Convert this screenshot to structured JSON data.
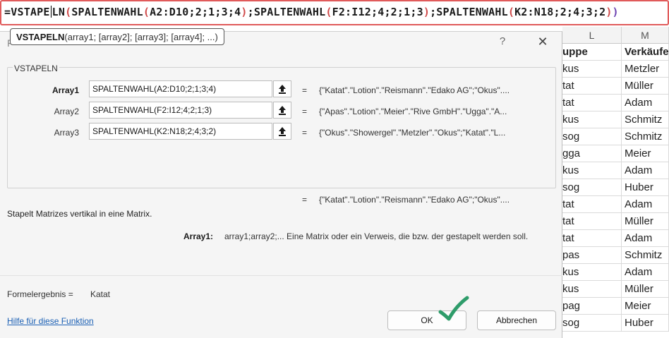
{
  "formula_bar": {
    "prefix": "=VSTAPE",
    "fn_suffix": "LN",
    "open_1": "(",
    "arg1_fn": "SPALTENWAHL",
    "arg1_open": "(",
    "arg1_body": "A2:D10;2;1;3;4",
    "arg1_close": ")",
    "sep1": ";",
    "arg2_fn": "SPALTENWAHL",
    "arg2_open": "(",
    "arg2_body": "F2:I12;4;2;1;3",
    "arg2_close": ")",
    "sep2": ";",
    "arg3_fn": "SPALTENWAHL",
    "arg3_open": "(",
    "arg3_body": "K2:N18;2;4;3;2",
    "arg3_close": ")",
    "close_1": ")"
  },
  "tooltip": {
    "function_name": "VSTAPELN",
    "signature": "(array1; [array2]; [array3]; [array4]; ...)"
  },
  "dialog": {
    "title_initial": "F",
    "help_glyph": "?",
    "close_glyph": "✕",
    "group_label": "VSTAPELN",
    "args": [
      {
        "label": "Array1",
        "input": "SPALTENWAHL(A2:D10;2;1;3;4)",
        "value": "{\"Katat\".\"Lotion\".\"Reismann\".\"Edako AG\";\"Okus\"...."
      },
      {
        "label": "Array2",
        "input": "SPALTENWAHL(F2:I12;4;2;1;3)",
        "value": "{\"Apas\".\"Lotion\".\"Meier\".\"Rive GmbH\".\"Ugga\".\"A..."
      },
      {
        "label": "Array3",
        "input": "SPALTENWAHL(K2:N18;2;4;3;2)",
        "value": "{\"Okus\".\"Showergel\".\"Metzler\".\"Okus\";\"Katat\".\"L..."
      }
    ],
    "equals": "=",
    "result_preview": "{\"Katat\".\"Lotion\".\"Reismann\".\"Edako AG\";\"Okus\"....",
    "description": "Stapelt Matrizes vertikal in eine Matrix.",
    "arg_help_label": "Array1:",
    "arg_help_text": "array1;array2;... Eine Matrix oder ein Verweis, die bzw. der gestapelt werden soll.",
    "result_label": "Formelergebnis =",
    "result_value": "Katat",
    "help_link": "Hilfe für diese Funktion",
    "ok_label": "OK",
    "cancel_label": "Abbrechen"
  },
  "sheet": {
    "columns": [
      "L",
      "M"
    ],
    "header_row": {
      "L": "uppe",
      "M": "Verkäufe"
    },
    "rows": [
      {
        "L": "kus",
        "M": "Metzler"
      },
      {
        "L": "tat",
        "M": "Müller"
      },
      {
        "L": "tat",
        "M": "Adam"
      },
      {
        "L": "kus",
        "M": "Schmitz"
      },
      {
        "L": "sog",
        "M": "Schmitz"
      },
      {
        "L": "gga",
        "M": "Meier"
      },
      {
        "L": "kus",
        "M": "Adam"
      },
      {
        "L": "sog",
        "M": "Huber"
      },
      {
        "L": "tat",
        "M": "Adam"
      },
      {
        "L": "tat",
        "M": "Müller"
      },
      {
        "L": "tat",
        "M": "Adam"
      },
      {
        "L": "pas",
        "M": "Schmitz"
      },
      {
        "L": "kus",
        "M": "Adam"
      },
      {
        "L": "kus",
        "M": "Müller"
      },
      {
        "L": "pag",
        "M": "Meier"
      },
      {
        "L": "sog",
        "M": "Huber"
      }
    ]
  },
  "colors": {
    "formula_border": "#e05a5a",
    "paren_1": "#d04a4a",
    "paren_2": "#6a3fb0",
    "checkmark": "#2e9c6a",
    "link": "#1a5fb4"
  },
  "icons": {
    "collapse": "upload-arrow-icon",
    "checkmark": "checkmark-icon"
  }
}
